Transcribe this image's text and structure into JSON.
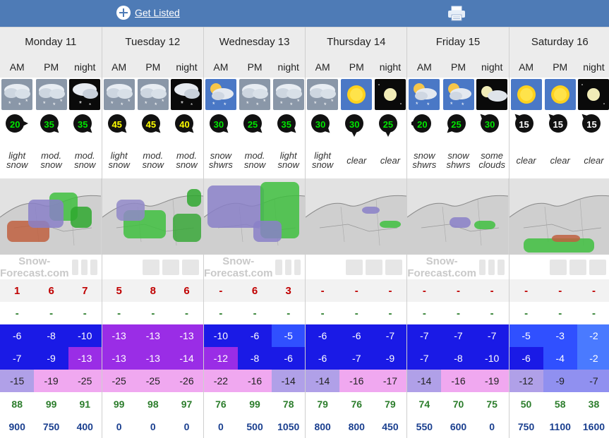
{
  "header": {
    "get_listed": "Get Listed",
    "printer_icon": "printer-icon"
  },
  "days": [
    {
      "name": "Monday 11",
      "periods": [
        {
          "label": "AM",
          "icon": "cloud-snow",
          "wind": "20",
          "wind_color": "#00e600",
          "wind_dir": "E",
          "desc": [
            "light",
            "snow"
          ],
          "snow": "1",
          "rain": "-",
          "max": "-6",
          "max_bg": "#1a1ae6",
          "min": "-7",
          "min_bg": "#1a1ae6",
          "chill": "-15",
          "chill_bg": "#b0a0e8",
          "hum": "88",
          "frz": "900"
        },
        {
          "label": "PM",
          "icon": "cloud-snow",
          "wind": "35",
          "wind_color": "#00e600",
          "wind_dir": "SE",
          "desc": [
            "mod.",
            "snow"
          ],
          "snow": "6",
          "rain": "-",
          "max": "-8",
          "max_bg": "#1a1ae6",
          "min": "-9",
          "min_bg": "#1a1ae6",
          "chill": "-19",
          "chill_bg": "#f0a8f0",
          "hum": "99",
          "frz": "750"
        },
        {
          "label": "night",
          "icon": "night-snow",
          "wind": "35",
          "wind_color": "#00e600",
          "wind_dir": "SE",
          "desc": [
            "mod.",
            "snow"
          ],
          "snow": "7",
          "rain": "-",
          "max": "-10",
          "max_bg": "#1a1ae6",
          "min": "-13",
          "min_bg": "#9a2de6",
          "chill": "-25",
          "chill_bg": "#f0a8f0",
          "hum": "91",
          "frz": "400"
        }
      ]
    },
    {
      "name": "Tuesday 12",
      "periods": [
        {
          "label": "AM",
          "icon": "cloud-snow",
          "wind": "45",
          "wind_color": "#ffff00",
          "wind_dir": "SE",
          "desc": [
            "light",
            "snow"
          ],
          "snow": "5",
          "rain": "-",
          "max": "-13",
          "max_bg": "#9a2de6",
          "min": "-13",
          "min_bg": "#9a2de6",
          "chill": "-25",
          "chill_bg": "#f0a8f0",
          "hum": "99",
          "frz": "0"
        },
        {
          "label": "PM",
          "icon": "cloud-snow",
          "wind": "45",
          "wind_color": "#ffff00",
          "wind_dir": "SE",
          "desc": [
            "mod.",
            "snow"
          ],
          "snow": "8",
          "rain": "-",
          "max": "-13",
          "max_bg": "#9a2de6",
          "min": "-13",
          "min_bg": "#9a2de6",
          "chill": "-25",
          "chill_bg": "#f0a8f0",
          "hum": "98",
          "frz": "0"
        },
        {
          "label": "night",
          "icon": "night-snow",
          "wind": "40",
          "wind_color": "#ffff00",
          "wind_dir": "SE",
          "desc": [
            "mod.",
            "snow"
          ],
          "snow": "6",
          "rain": "-",
          "max": "-13",
          "max_bg": "#9a2de6",
          "min": "-14",
          "min_bg": "#9a2de6",
          "chill": "-26",
          "chill_bg": "#f0a8f0",
          "hum": "97",
          "frz": "0"
        }
      ]
    },
    {
      "name": "Wednesday 13",
      "periods": [
        {
          "label": "AM",
          "icon": "sun-cloud-snow",
          "wind": "30",
          "wind_color": "#00e600",
          "wind_dir": "SE",
          "desc": [
            "snow",
            "shwrs"
          ],
          "snow": "-",
          "rain": "-",
          "max": "-10",
          "max_bg": "#1a1ae6",
          "min": "-12",
          "min_bg": "#9a2de6",
          "chill": "-22",
          "chill_bg": "#f0a8f0",
          "hum": "76",
          "frz": "0"
        },
        {
          "label": "PM",
          "icon": "cloud-snow",
          "wind": "25",
          "wind_color": "#00e600",
          "wind_dir": "SE",
          "desc": [
            "mod.",
            "snow"
          ],
          "snow": "6",
          "rain": "-",
          "max": "-6",
          "max_bg": "#1a1ae6",
          "min": "-8",
          "min_bg": "#1a1ae6",
          "chill": "-16",
          "chill_bg": "#f0a8f0",
          "hum": "99",
          "frz": "500"
        },
        {
          "label": "night",
          "icon": "cloud-snow",
          "wind": "35",
          "wind_color": "#00e600",
          "wind_dir": "SE",
          "desc": [
            "light",
            "snow"
          ],
          "snow": "3",
          "rain": "-",
          "max": "-5",
          "max_bg": "#3050ff",
          "min": "-6",
          "min_bg": "#1a1ae6",
          "chill": "-14",
          "chill_bg": "#b0a0e8",
          "hum": "78",
          "frz": "1050"
        }
      ]
    },
    {
      "name": "Thursday 14",
      "periods": [
        {
          "label": "AM",
          "icon": "cloud-snow",
          "wind": "30",
          "wind_color": "#00e600",
          "wind_dir": "SE",
          "desc": [
            "light",
            "snow"
          ],
          "snow": "-",
          "rain": "-",
          "max": "-6",
          "max_bg": "#1a1ae6",
          "min": "-6",
          "min_bg": "#1a1ae6",
          "chill": "-14",
          "chill_bg": "#b0a0e8",
          "hum": "79",
          "frz": "800"
        },
        {
          "label": "PM",
          "icon": "sun",
          "wind": "30",
          "wind_color": "#00e600",
          "wind_dir": "S",
          "desc": [
            "clear"
          ],
          "snow": "-",
          "rain": "-",
          "max": "-6",
          "max_bg": "#1a1ae6",
          "min": "-7",
          "min_bg": "#1a1ae6",
          "chill": "-16",
          "chill_bg": "#f0a8f0",
          "hum": "76",
          "frz": "800"
        },
        {
          "label": "night",
          "icon": "moon",
          "wind": "25",
          "wind_color": "#00e600",
          "wind_dir": "S",
          "desc": [
            "clear"
          ],
          "snow": "-",
          "rain": "-",
          "max": "-7",
          "max_bg": "#1a1ae6",
          "min": "-9",
          "min_bg": "#1a1ae6",
          "chill": "-17",
          "chill_bg": "#f0a8f0",
          "hum": "79",
          "frz": "450"
        }
      ]
    },
    {
      "name": "Friday 15",
      "periods": [
        {
          "label": "AM",
          "icon": "sun-cloud-snow",
          "wind": "20",
          "wind_color": "#00e600",
          "wind_dir": "W",
          "desc": [
            "snow",
            "shwrs"
          ],
          "snow": "-",
          "rain": "-",
          "max": "-7",
          "max_bg": "#1a1ae6",
          "min": "-7",
          "min_bg": "#1a1ae6",
          "chill": "-14",
          "chill_bg": "#b0a0e8",
          "hum": "74",
          "frz": "550"
        },
        {
          "label": "PM",
          "icon": "sun-cloud-snow",
          "wind": "25",
          "wind_color": "#00e600",
          "wind_dir": "SW",
          "desc": [
            "snow",
            "shwrs"
          ],
          "snow": "-",
          "rain": "-",
          "max": "-7",
          "max_bg": "#1a1ae6",
          "min": "-8",
          "min_bg": "#1a1ae6",
          "chill": "-16",
          "chill_bg": "#f0a8f0",
          "hum": "70",
          "frz": "600"
        },
        {
          "label": "night",
          "icon": "moon-cloud",
          "wind": "30",
          "wind_color": "#00e600",
          "wind_dir": "NW",
          "desc": [
            "some",
            "clouds"
          ],
          "snow": "-",
          "rain": "-",
          "max": "-7",
          "max_bg": "#1a1ae6",
          "min": "-10",
          "min_bg": "#1a1ae6",
          "chill": "-19",
          "chill_bg": "#f0a8f0",
          "hum": "75",
          "frz": "0"
        }
      ]
    },
    {
      "name": "Saturday 16",
      "periods": [
        {
          "label": "AM",
          "icon": "sun",
          "wind": "15",
          "wind_color": "#ffffff",
          "wind_dir": "NW",
          "desc": [
            "clear"
          ],
          "snow": "-",
          "rain": "-",
          "max": "-5",
          "max_bg": "#3050ff",
          "min": "-6",
          "min_bg": "#1a1ae6",
          "chill": "-12",
          "chill_bg": "#b0a0e8",
          "hum": "50",
          "frz": "750"
        },
        {
          "label": "PM",
          "icon": "sun",
          "wind": "15",
          "wind_color": "#ffffff",
          "wind_dir": "NW",
          "desc": [
            "clear"
          ],
          "snow": "-",
          "rain": "-",
          "max": "-3",
          "max_bg": "#3050ff",
          "min": "-4",
          "min_bg": "#3050ff",
          "chill": "-9",
          "chill_bg": "#9090f0",
          "hum": "58",
          "frz": "1100"
        },
        {
          "label": "night",
          "icon": "moon",
          "wind": "15",
          "wind_color": "#ffffff",
          "wind_dir": "NW",
          "desc": [
            "clear"
          ],
          "snow": "-",
          "rain": "-",
          "max": "-2",
          "max_bg": "#4a7aff",
          "min": "-2",
          "min_bg": "#4a7aff",
          "chill": "-7",
          "chill_bg": "#9090f0",
          "hum": "38",
          "frz": "1600"
        }
      ]
    }
  ],
  "maps": [
    {
      "brand": "Snow-Forecast.com"
    },
    {
      "brand": ""
    },
    {
      "brand": "Snow-Forecast.com"
    },
    {
      "brand": ""
    },
    {
      "brand": "Snow-Forecast.com"
    },
    {
      "brand": ""
    }
  ]
}
